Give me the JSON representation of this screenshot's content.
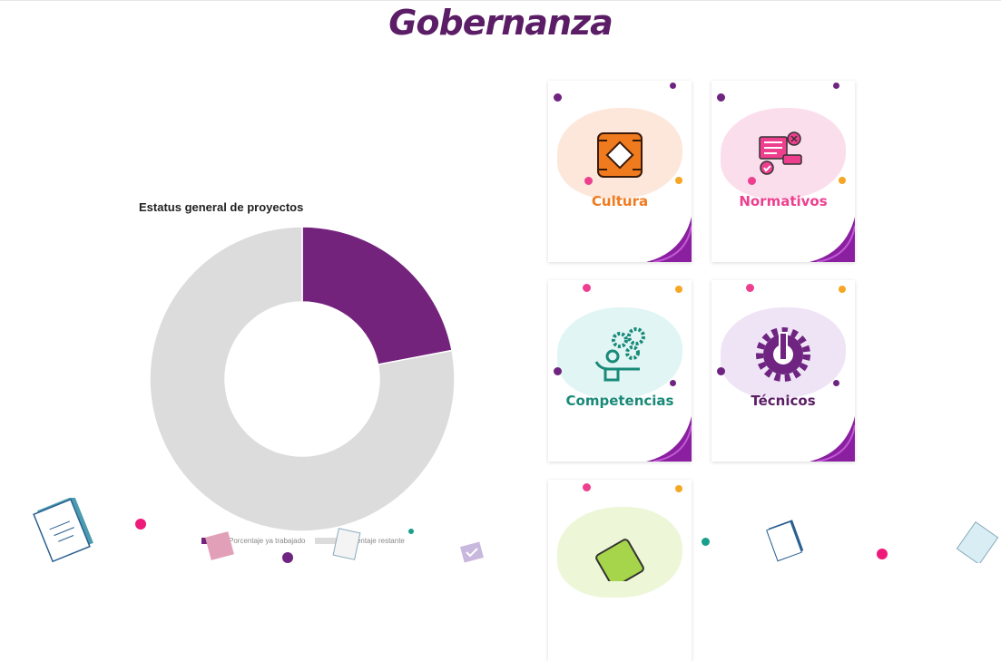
{
  "header": {
    "title": "Gobernanza"
  },
  "chart_data": {
    "type": "pie",
    "title": "Estatus general de proyectos",
    "categories": [
      "Porcentaje ya trabajado",
      "Porcentaje restante"
    ],
    "values": [
      22,
      78
    ],
    "colors": [
      "#74237d",
      "#dcdcdc"
    ],
    "donut": true,
    "legend": "bottom"
  },
  "cards": [
    {
      "label": "Cultura",
      "color": "#f07a1e",
      "blob": "#fbd4bd",
      "icon": "handshake-icon"
    },
    {
      "label": "Normativos",
      "color": "#ee3f8f",
      "blob": "#f8c3dd",
      "icon": "document-icon"
    },
    {
      "label": "Competencias",
      "color": "#198a78",
      "blob": "#c9ecec",
      "icon": "gears-person-icon"
    },
    {
      "label": "Técnicos",
      "color": "#5b1d66",
      "blob": "#e2cdee",
      "icon": "wrench-gear-icon"
    },
    {
      "label": "",
      "color": "#5a8f1a",
      "blob": "#dff0b8",
      "icon": "blueprint-icon"
    }
  ]
}
